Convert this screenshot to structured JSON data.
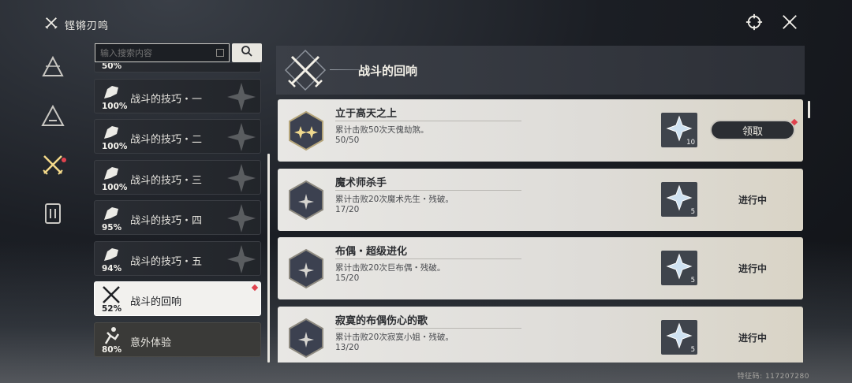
{
  "header": {
    "title": "铿锵刃鸣"
  },
  "search": {
    "placeholder": "输入搜索内容"
  },
  "categories": [
    {
      "label": "",
      "percent": "50%"
    },
    {
      "label": "战斗的技巧・一",
      "percent": "100%"
    },
    {
      "label": "战斗的技巧・二",
      "percent": "100%"
    },
    {
      "label": "战斗的技巧・三",
      "percent": "100%"
    },
    {
      "label": "战斗的技巧・四",
      "percent": "95%"
    },
    {
      "label": "战斗的技巧・五",
      "percent": "94%"
    },
    {
      "label": "战斗的回响",
      "percent": "52%"
    },
    {
      "label": "意外体验",
      "percent": "80%"
    }
  ],
  "detail": {
    "title": "战斗的回响"
  },
  "achievements": [
    {
      "title": "立于高天之上",
      "desc": "累计击败50次天傀劫煞。",
      "progress": "50/50",
      "reward_qty": "10",
      "action": "领取"
    },
    {
      "title": "魔术师杀手",
      "desc": "累计击败20次魔术先生・残破。",
      "progress": "17/20",
      "reward_qty": "5",
      "action": "进行中"
    },
    {
      "title": "布偶・超级进化",
      "desc": "累计击败20次巨布偶・残破。",
      "progress": "15/20",
      "reward_qty": "5",
      "action": "进行中"
    },
    {
      "title": "寂寞的布偶伤心的歌",
      "desc": "累计击败20次寂寞小姐・残破。",
      "progress": "13/20",
      "reward_qty": "5",
      "action": "进行中"
    }
  ],
  "footer": {
    "uid": "特征码: 117207280"
  },
  "colors": {
    "accent_red": "#e0424e",
    "card_light": "#e8e7e4",
    "panel_dark": "#2a2d33"
  }
}
